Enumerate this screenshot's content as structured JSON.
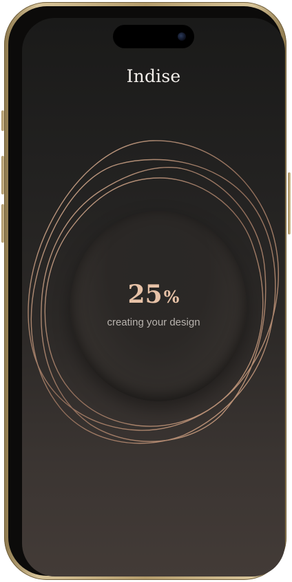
{
  "app": {
    "brand": "Indise"
  },
  "progress": {
    "value": "25",
    "unit": "%"
  },
  "status": {
    "text": "creating your design"
  },
  "colors": {
    "accent": "#e7c2a7",
    "ring": "#c99a7c",
    "bezel": "#b59d6c"
  },
  "icons": {
    "camera": "front-camera-icon"
  }
}
